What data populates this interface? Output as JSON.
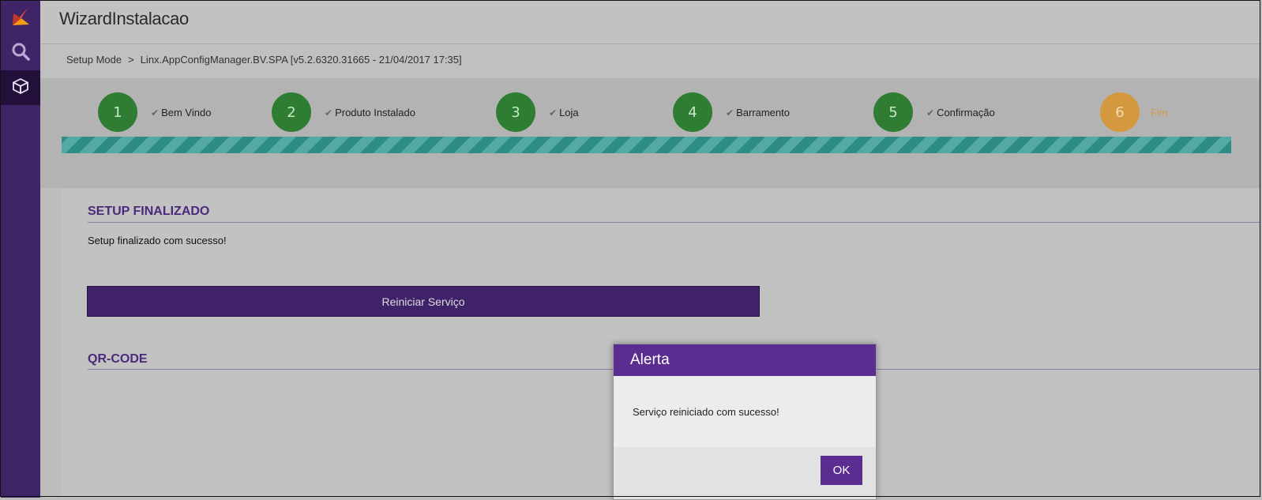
{
  "app": {
    "title": "WizardInstalacao"
  },
  "breadcrumb": {
    "root": "Setup Mode",
    "separator": ">",
    "current": "Linx.AppConfigManager.BV.SPA [v5.2.6320.31665 - 21/04/2017 17:35]"
  },
  "sidebar": {
    "items": [
      {
        "icon": "logo-icon",
        "active": false
      },
      {
        "icon": "search-icon",
        "active": false
      },
      {
        "icon": "cube-icon",
        "active": true
      }
    ]
  },
  "wizard": {
    "steps": [
      {
        "number": "1",
        "label": "Bem Vindo",
        "status": "done",
        "check": "✔"
      },
      {
        "number": "2",
        "label": "Produto Instalado",
        "status": "done",
        "check": "✔"
      },
      {
        "number": "3",
        "label": "Loja",
        "status": "done",
        "check": "✔"
      },
      {
        "number": "4",
        "label": "Barramento",
        "status": "done",
        "check": "✔"
      },
      {
        "number": "5",
        "label": "Confirmação",
        "status": "done",
        "check": "✔"
      },
      {
        "number": "6",
        "label": "Fim",
        "status": "current"
      }
    ],
    "progress": 1.0,
    "colors": {
      "done": "#2e7d32",
      "current": "#d4993f",
      "progress": "#2d8d86"
    }
  },
  "content": {
    "setup_title": "SETUP FINALIZADO",
    "setup_message": "Setup finalizado com sucesso!",
    "restart_button": "Reiniciar Serviço",
    "qr_title": "QR-CODE"
  },
  "modal": {
    "title": "Alerta",
    "message": "Serviço reiniciado com sucesso!",
    "ok_label": "OK"
  },
  "colors": {
    "accent": "#5c2d91",
    "sidebar": "#3f2468"
  }
}
